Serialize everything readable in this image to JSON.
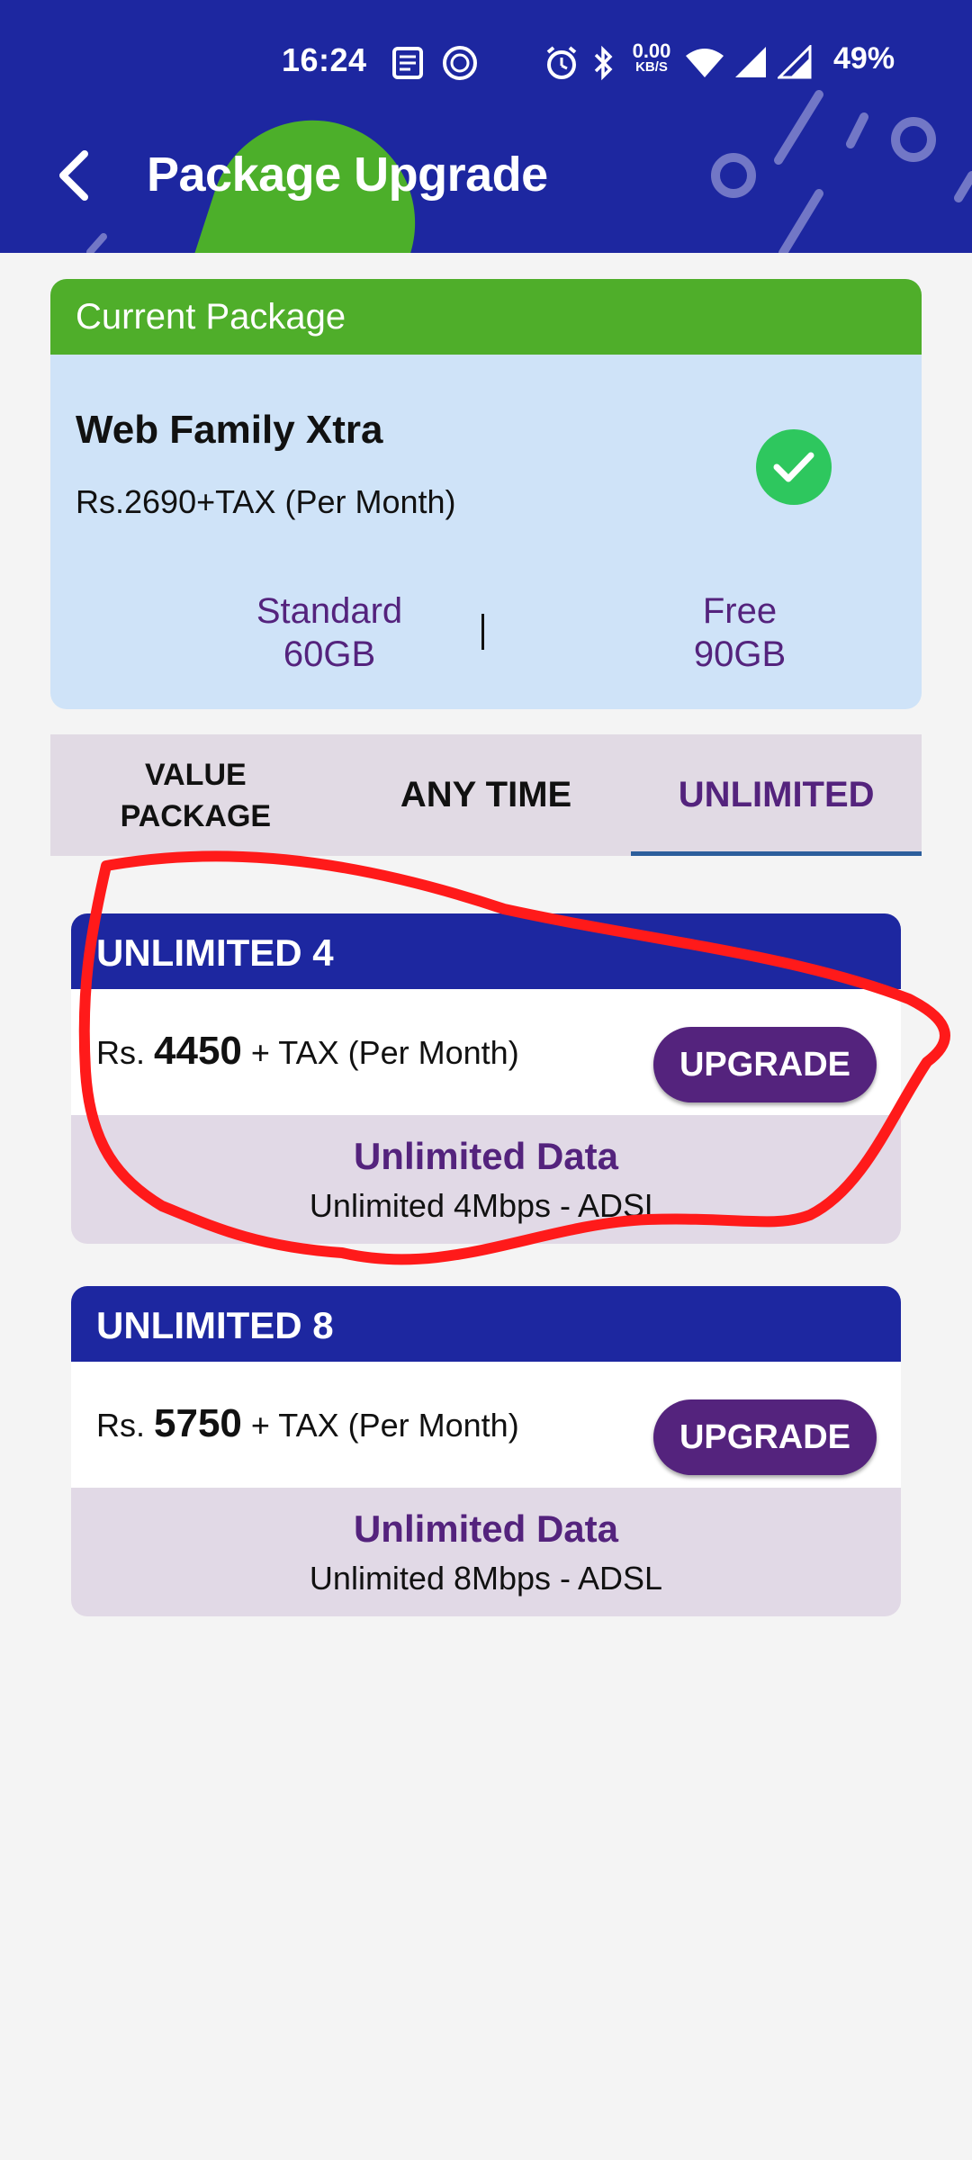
{
  "status_bar": {
    "time": "16:24",
    "net_speed": "0.00",
    "net_unit": "KB/S",
    "battery": "49%"
  },
  "header": {
    "title": "Package Upgrade"
  },
  "current_package": {
    "heading": "Current Package",
    "name": "Web Family Xtra",
    "price": "Rs.2690+TAX (Per Month)",
    "standard_label": "Standard",
    "standard_value": "60GB",
    "free_label": "Free",
    "free_value": "90GB"
  },
  "tabs": [
    {
      "line1": "VALUE",
      "line2": "PACKAGE"
    },
    {
      "label": "ANY TIME"
    },
    {
      "label": "UNLIMITED",
      "selected": true
    }
  ],
  "plans": [
    {
      "name": "UNLIMITED 4",
      "currency": "Rs.",
      "amount": "4450",
      "suffix": "+ TAX (Per Month)",
      "button": "UPGRADE",
      "feature": "Unlimited Data",
      "description": "Unlimited 4Mbps - ADSL"
    },
    {
      "name": "UNLIMITED 8",
      "currency": "Rs.",
      "amount": "5750",
      "suffix": "+ TAX (Per Month)",
      "button": "UPGRADE",
      "feature": "Unlimited Data",
      "description": "Unlimited 8Mbps - ADSL"
    }
  ],
  "colors": {
    "header_bg": "#1d27a0",
    "accent_green": "#4fae2a",
    "accent_purple": "#54237d",
    "annotation_red": "#ff1a1a"
  }
}
